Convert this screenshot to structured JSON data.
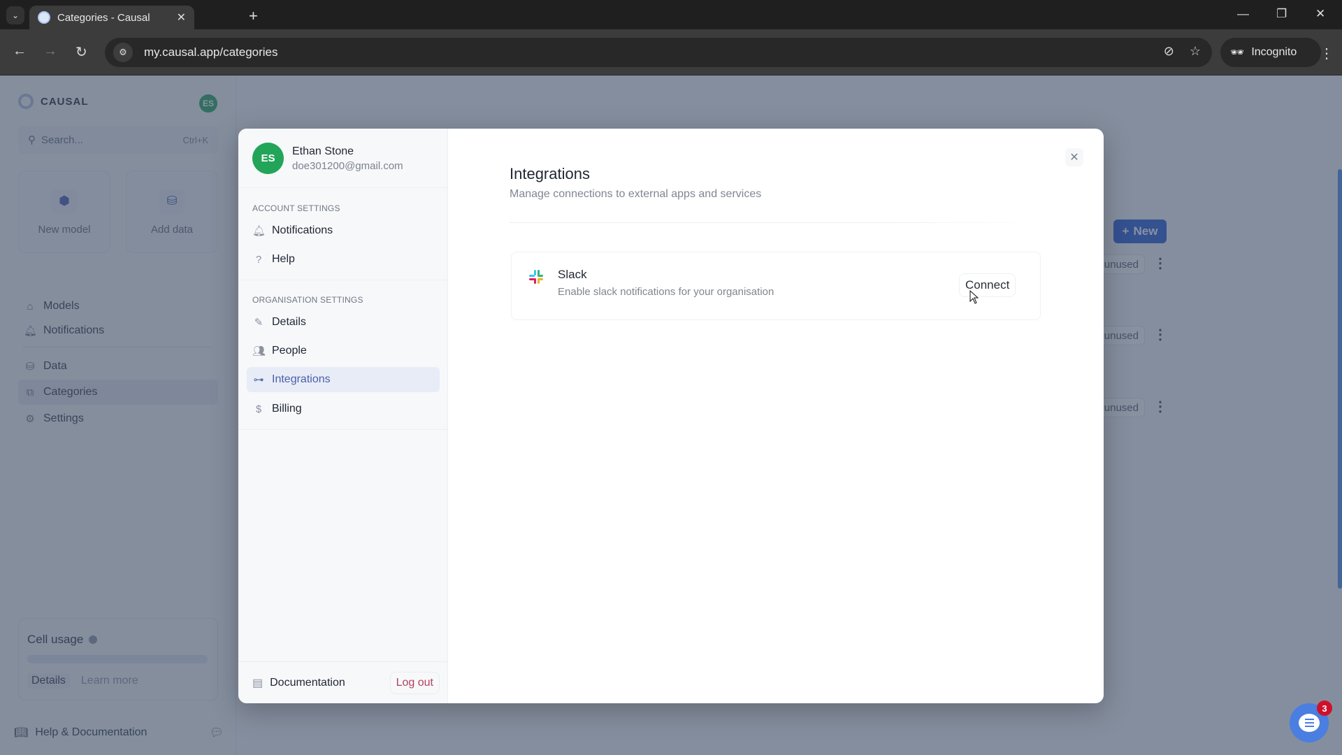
{
  "browser": {
    "tab_title": "Categories - Causal",
    "url": "my.causal.app/categories",
    "incognito_label": "Incognito"
  },
  "app": {
    "brand": "CAUSAL",
    "user_initials": "ES",
    "search_placeholder": "Search...",
    "search_shortcut": "Ctrl+K",
    "quick_actions": [
      {
        "label": "New model",
        "icon": "cube-icon"
      },
      {
        "label": "Add data",
        "icon": "database-icon"
      }
    ],
    "nav_primary": [
      {
        "label": "Models",
        "icon": "home-icon"
      },
      {
        "label": "Notifications",
        "icon": "bell-icon"
      }
    ],
    "nav_secondary": [
      {
        "label": "Data",
        "icon": "database-icon"
      },
      {
        "label": "Categories",
        "icon": "categories-icon",
        "active": true
      },
      {
        "label": "Settings",
        "icon": "gear-icon"
      }
    ],
    "cell_usage": {
      "title": "Cell usage",
      "fraction": 0.0,
      "details_label": "Details",
      "learn_more_label": "Learn more"
    },
    "help_label": "Help & Documentation",
    "new_button_label": "New",
    "rows": [
      {
        "status": "unused"
      },
      {
        "status": "unused"
      },
      {
        "status": "unused"
      }
    ],
    "chat_badge_count": "3"
  },
  "modal": {
    "user": {
      "initials": "ES",
      "name": "Ethan Stone",
      "email": "doe301200@gmail.com"
    },
    "account_section": "ACCOUNT SETTINGS",
    "account_items": [
      {
        "label": "Notifications",
        "icon": "bell-icon"
      },
      {
        "label": "Help",
        "icon": "help-icon"
      }
    ],
    "org_section": "ORGANISATION SETTINGS",
    "org_items": [
      {
        "label": "Details",
        "icon": "pencil-icon"
      },
      {
        "label": "People",
        "icon": "people-icon"
      },
      {
        "label": "Integrations",
        "icon": "integrations-icon",
        "active": true
      },
      {
        "label": "Billing",
        "icon": "dollar-icon"
      }
    ],
    "documentation_label": "Documentation",
    "logout_label": "Log out",
    "content": {
      "title": "Integrations",
      "subtitle": "Manage connections to external apps and services",
      "integrations": [
        {
          "name": "Slack",
          "description": "Enable slack notifications for your organisation",
          "action_label": "Connect"
        }
      ]
    }
  }
}
